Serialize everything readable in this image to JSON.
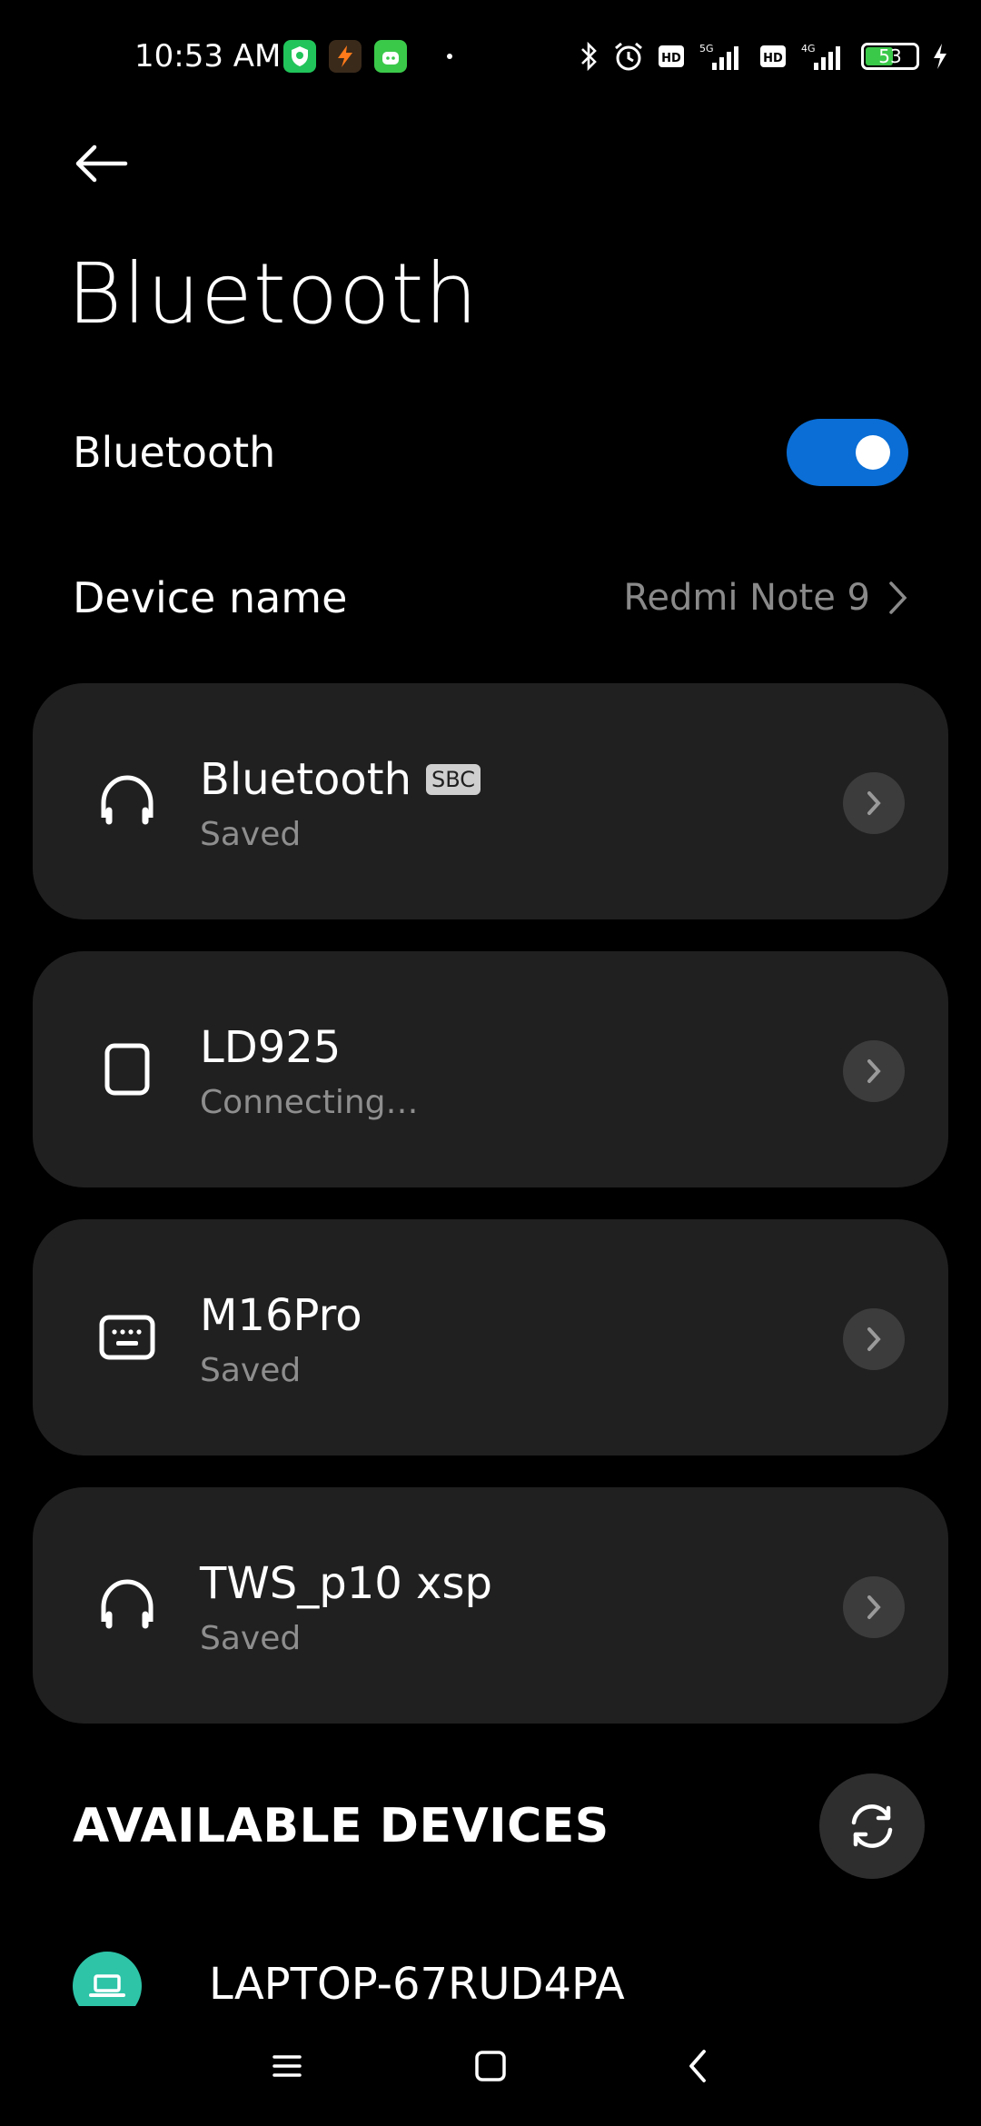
{
  "status_bar": {
    "time": "10:53 AM",
    "battery": "53",
    "network_labels": [
      "HD",
      "5G",
      "HD",
      "4G"
    ]
  },
  "page": {
    "title": "Bluetooth"
  },
  "bluetooth_toggle": {
    "label": "Bluetooth",
    "on": true
  },
  "device_name": {
    "label": "Device name",
    "value": "Redmi Note 9"
  },
  "paired_devices": [
    {
      "name": "Bluetooth",
      "badge": "SBC",
      "status": "Saved",
      "icon": "headphones-icon"
    },
    {
      "name": "LD925",
      "badge": "",
      "status": "Connecting…",
      "icon": "watch-icon"
    },
    {
      "name": "M16Pro",
      "badge": "",
      "status": "Saved",
      "icon": "keyboard-icon"
    },
    {
      "name": "TWS_p10 xsp",
      "badge": "",
      "status": "Saved",
      "icon": "headphones-icon"
    }
  ],
  "available": {
    "title": "AVAILABLE DEVICES",
    "devices": [
      {
        "name": "LAPTOP-67RUD4PA",
        "icon": "laptop-icon"
      }
    ]
  },
  "colors": {
    "accent": "#0a6ed6",
    "card": "#202020",
    "laptop": "#2ec4a8"
  }
}
